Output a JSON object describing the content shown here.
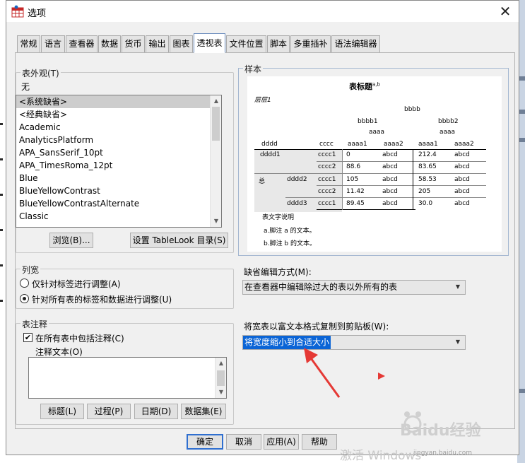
{
  "window": {
    "title": "选项",
    "close_label": "✕"
  },
  "tabs": [
    {
      "label": "常规"
    },
    {
      "label": "语言"
    },
    {
      "label": "查看器"
    },
    {
      "label": "数据"
    },
    {
      "label": "货币"
    },
    {
      "label": "输出"
    },
    {
      "label": "图表"
    },
    {
      "label": "透视表",
      "active": true
    },
    {
      "label": "文件位置"
    },
    {
      "label": "脚本"
    },
    {
      "label": "多重插补"
    },
    {
      "label": "语法编辑器"
    }
  ],
  "appearance": {
    "group_label": "表外观(T)",
    "current_value": "无",
    "items": [
      "<系统缺省>",
      "<经典缺省>",
      "Academic",
      "AnalyticsPlatform",
      "APA_SansSerif_10pt",
      "APA_TimesRoma_12pt",
      "Blue",
      "BlueYellowContrast",
      "BlueYellowContrastAlternate",
      "Classic"
    ],
    "selected_index": 0,
    "browse_button": "浏览(B)...",
    "set_dir_button": "设置 TableLook 目录(S)"
  },
  "sample": {
    "group_label": "样本",
    "title": "表标题",
    "title_sup": "a,b",
    "layer": "层层1",
    "col_dim": "bbbb",
    "col_b1": "bbbb1",
    "col_b2": "bbbb2",
    "col_a": "aaaa",
    "col_a1": "aaaa1",
    "col_a2": "aaaa2",
    "row_d": "dddd",
    "row_c": "cccc",
    "row_d1": "dddd1",
    "row_total": "总",
    "row_d2": "dddd2",
    "row_d3": "dddd3",
    "c1": "cccc1",
    "c2": "cccc2",
    "r1": [
      "0",
      "abcd",
      "212.4",
      "abcd"
    ],
    "r2": [
      "88.6",
      "abcd",
      "83.65",
      "abcd"
    ],
    "r3": [
      "105",
      "abcd",
      "58.53",
      "abcd"
    ],
    "r4": [
      "11.42",
      "abcd",
      "205",
      "abcd"
    ],
    "r5": [
      "89.45",
      "abcd",
      "30.0",
      "abcd"
    ],
    "caption": "表文字说明",
    "note_a": "a.脚注 a 的文本。",
    "note_b": "b.脚注 b 的文本。"
  },
  "column_width": {
    "group_label": "列宽",
    "option1": "仅针对标签进行调整(A)",
    "option2": "针对所有表的标签和数据进行调整(U)",
    "selected": 2
  },
  "notes": {
    "group_label": "表注释",
    "include_label": "在所有表中包括注释(C)",
    "include_checked": true,
    "text_label": "注释文本(O)",
    "text_value": "",
    "buttons": [
      "标题(L)",
      "过程(P)",
      "日期(D)",
      "数据集(E)"
    ]
  },
  "edit_mode": {
    "label": "缺省编辑方式(M):",
    "value": "在查看器中编辑除过大的表以外所有的表"
  },
  "copy_mode": {
    "label": "将宽表以富文本格式复制到剪贴板(W):",
    "value": "将宽度缩小到合适大小"
  },
  "footer": {
    "ok": "确定",
    "cancel": "取消",
    "apply": "应用(A)",
    "help": "帮助"
  },
  "overlay": {
    "activate_text": "激活 Windows",
    "watermark_text": "Baidu经验",
    "watermark_site": "jingyan.baidu.com",
    "arrow_color": "#e53935"
  }
}
